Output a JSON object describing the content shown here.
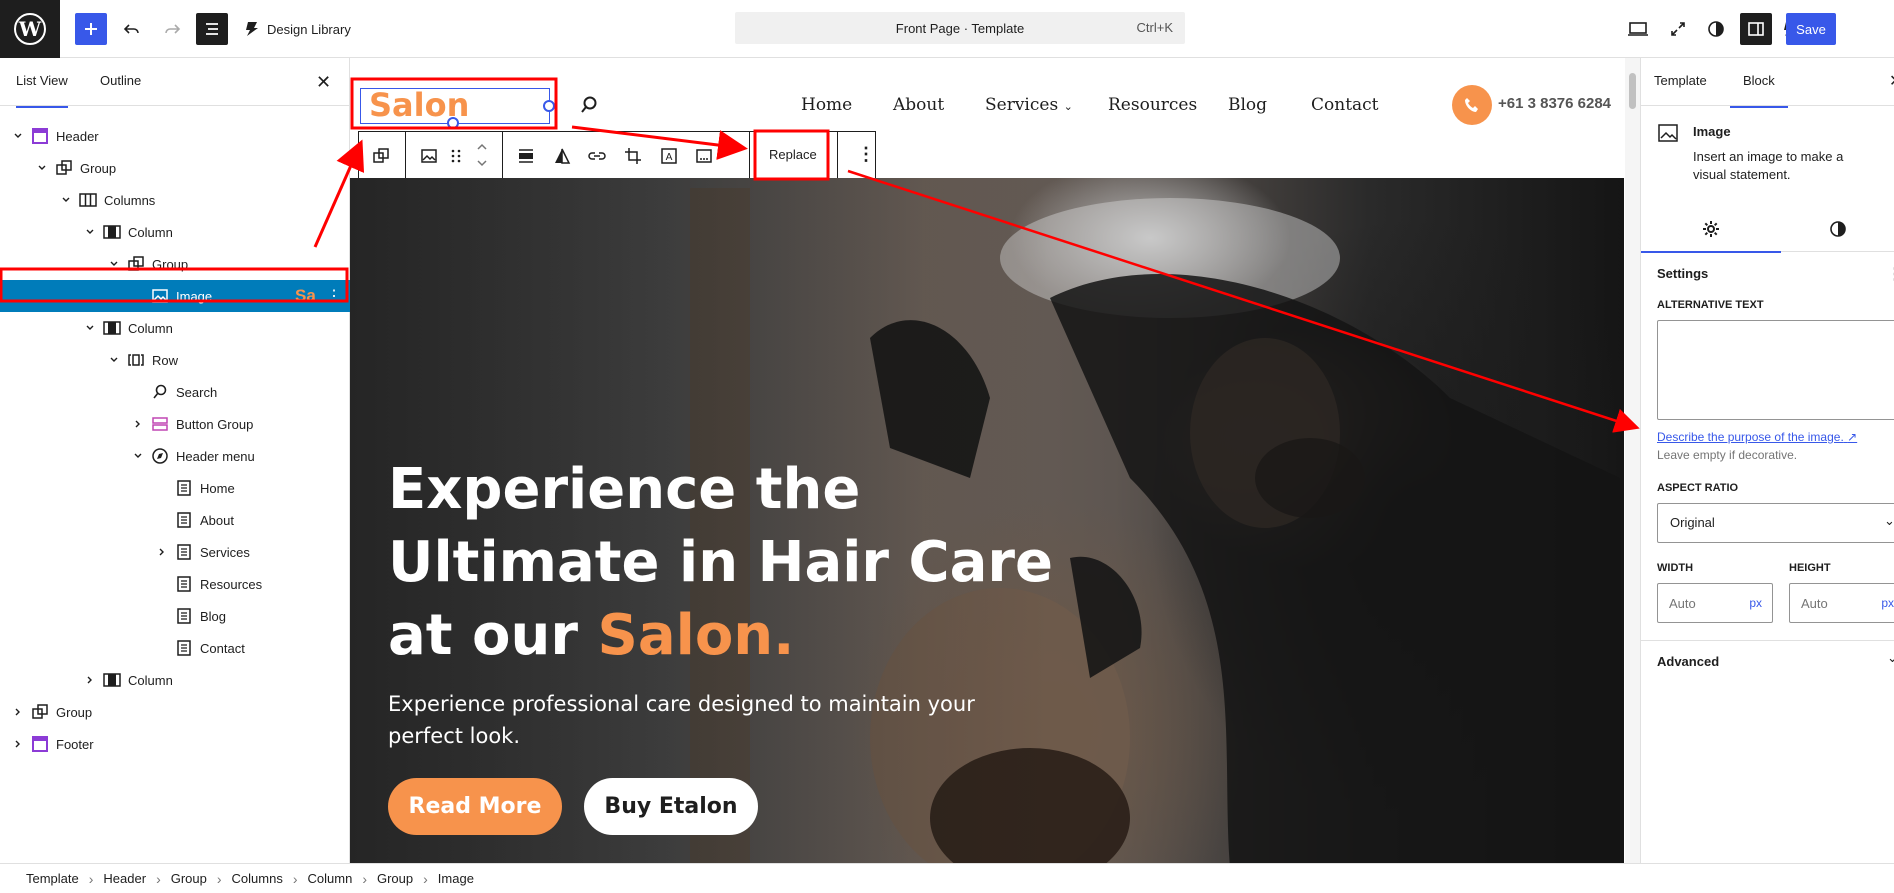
{
  "topbar": {
    "library_label": "Design Library",
    "document_title": "Front Page · Template",
    "shortcut": "Ctrl+K",
    "save_label": "Save"
  },
  "list_view": {
    "tabs": [
      "List View",
      "Outline"
    ],
    "items": [
      {
        "label": "Header"
      },
      {
        "label": "Group"
      },
      {
        "label": "Columns"
      },
      {
        "label": "Column"
      },
      {
        "label": "Group"
      },
      {
        "label": "Image",
        "trail": "Sa"
      },
      {
        "label": "Column"
      },
      {
        "label": "Row"
      },
      {
        "label": "Search"
      },
      {
        "label": "Button Group"
      },
      {
        "label": "Header menu"
      },
      {
        "label": "Home"
      },
      {
        "label": "About"
      },
      {
        "label": "Services"
      },
      {
        "label": "Resources"
      },
      {
        "label": "Blog"
      },
      {
        "label": "Contact"
      },
      {
        "label": "Column"
      },
      {
        "label": "Group"
      },
      {
        "label": "Footer"
      }
    ]
  },
  "site": {
    "logo_text": "Salon",
    "nav": [
      "Home",
      "About",
      "Services",
      "Resources",
      "Blog",
      "Contact"
    ],
    "phone": "+61 3 8376 6284",
    "toolbar_replace": "Replace",
    "hero_line1": "Experience the",
    "hero_line2": "Ultimate in Hair Care",
    "hero_line3_prefix": "at our ",
    "hero_line3_accent": "Salon.",
    "hero_sub": "Experience professional care designed to maintain your perfect look.",
    "btn_read_more": "Read More",
    "btn_buy": "Buy Etalon"
  },
  "inspector": {
    "tabs": [
      "Template",
      "Block"
    ],
    "block_title": "Image",
    "block_desc": "Insert an image to make a visual statement.",
    "section_title": "Settings",
    "alt_label": "ALTERNATIVE TEXT",
    "alt_link": "Describe the purpose of the image.",
    "alt_help": "Leave empty if decorative.",
    "aspect_label": "ASPECT RATIO",
    "aspect_value": "Original",
    "width_label": "WIDTH",
    "height_label": "HEIGHT",
    "auto_placeholder": "Auto",
    "unit": "px",
    "advanced_label": "Advanced"
  },
  "breadcrumb": [
    "Template",
    "Header",
    "Group",
    "Columns",
    "Column",
    "Group",
    "Image"
  ],
  "colors": {
    "accent": "#3858e9",
    "brand_orange": "#f7934c",
    "selection": "#007cba",
    "annotation_red": "#ff0000"
  }
}
